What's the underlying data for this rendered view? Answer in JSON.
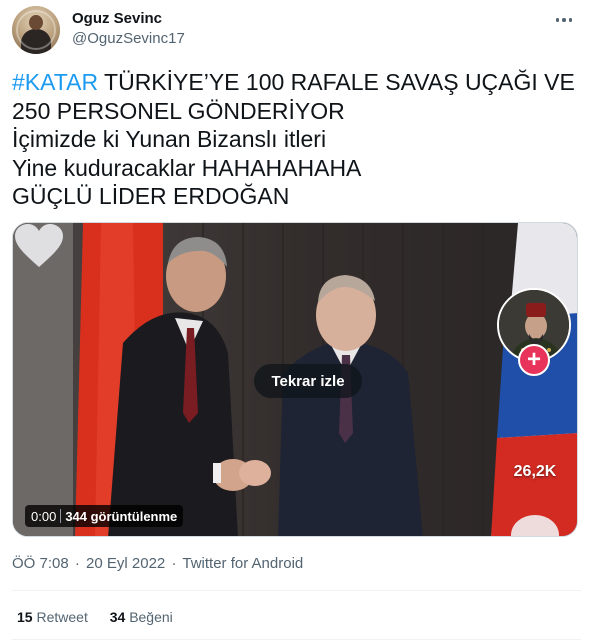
{
  "user": {
    "display_name": "Oguz Sevinc",
    "handle": "@OguzSevinc17"
  },
  "tweet": {
    "hashtag": "#KATAR",
    "line1_rest": " TÜRKİYE’YE 100 RAFALE SAVAŞ UÇAĞI VE",
    "line2": "250 PERSONEL GÖNDERİYOR",
    "line3": "İçimizde ki Yunan Bizanslı itleri",
    "line4": "Yine kuduracaklar HAHAHAHAHA",
    "line5": "GÜÇLÜ LİDER ERDOĞAN"
  },
  "media": {
    "replay_label": "Tekrar izle",
    "time": "0:00",
    "views": "344 görüntülenme",
    "tiktok_like_count": "26,2K"
  },
  "meta": {
    "time": "ÖÖ 7:08",
    "date": "20 Eyl 2022",
    "source": "Twitter for Android",
    "separator": "·"
  },
  "stats": {
    "retweets_count": "15",
    "retweets_label": "Retweet",
    "likes_count": "34",
    "likes_label": "Beğeni"
  },
  "colors": {
    "link": "#1d9bf0",
    "text": "#0f1419",
    "secondary": "#536471"
  },
  "icons": [
    "more-icon",
    "heart-icon",
    "plus-icon"
  ]
}
